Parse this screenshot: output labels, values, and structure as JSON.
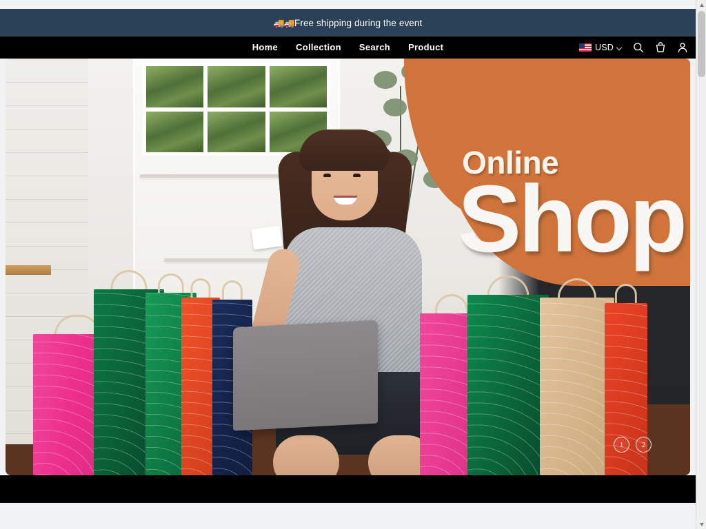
{
  "announcement": {
    "emoji": "🚚🚚",
    "text": "Free shipping during the event"
  },
  "header": {
    "logo_alt": "store-logo",
    "nav": [
      {
        "label": "Home"
      },
      {
        "label": "Collection"
      },
      {
        "label": "Search"
      },
      {
        "label": "Product"
      }
    ],
    "actions": {
      "flag": "us-flag",
      "currency": "USD",
      "chevron": "chevron-down-icon",
      "search": "search-icon",
      "cart": "cart-icon",
      "account": "account-icon"
    }
  },
  "hero": {
    "overline": "Online",
    "headline": "Shop",
    "accent_color": "#d1743b",
    "slides": [
      {
        "label": "1"
      },
      {
        "label": "2"
      }
    ]
  },
  "colors": {
    "announcement_bg": "#2b4157",
    "header_bg": "#000000",
    "page_bg": "#f1f2f4",
    "hero_accent": "#d1743b"
  }
}
